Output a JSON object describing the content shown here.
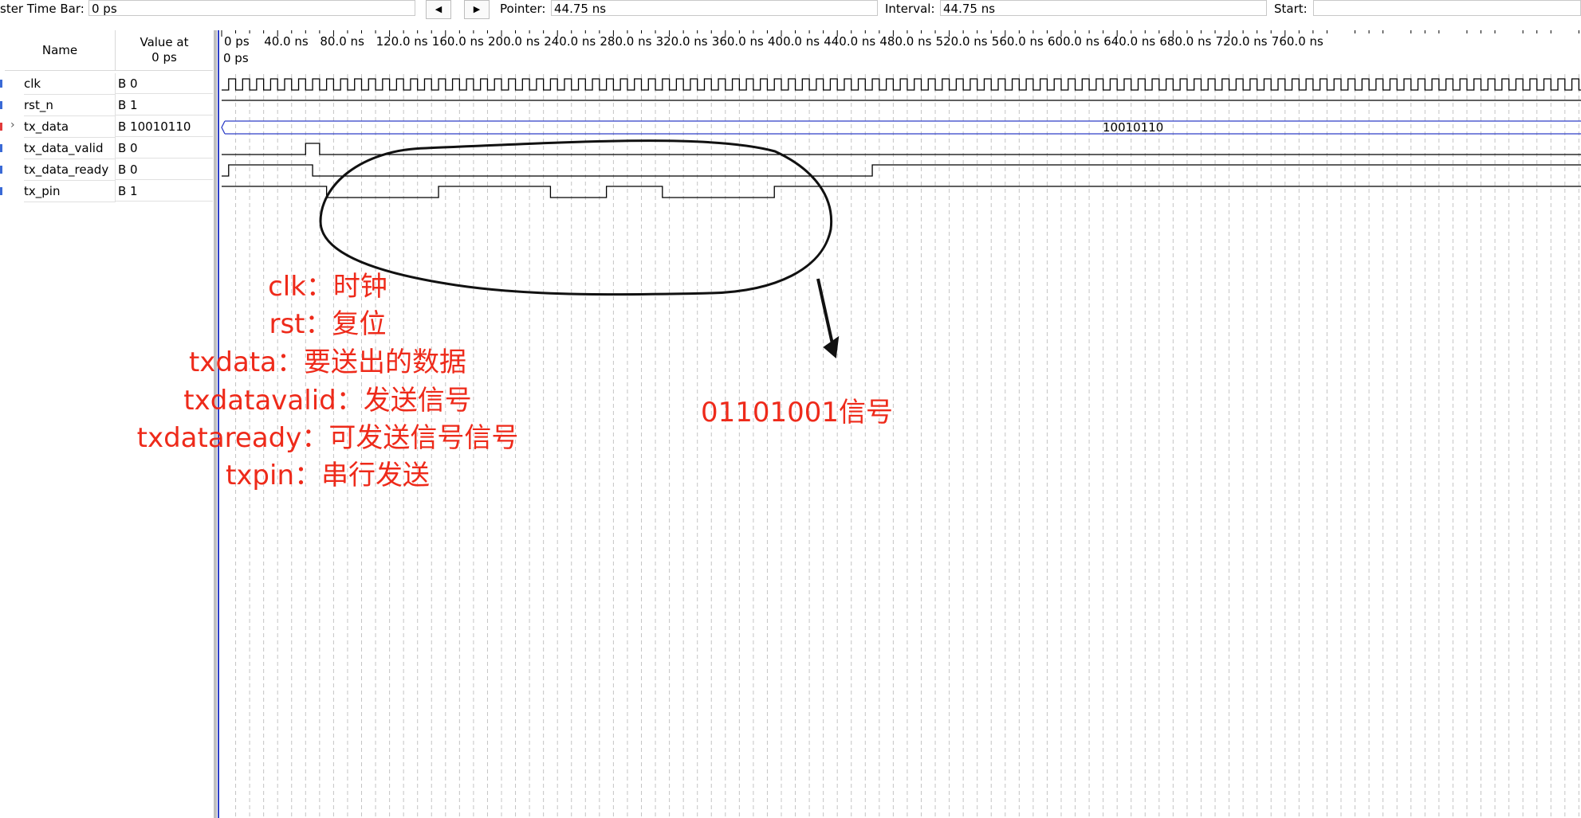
{
  "toolbar": {
    "master_label": "ster Time Bar:",
    "master_value": "0 ps",
    "prev_icon": "triangle-left-icon",
    "next_icon": "triangle-right-icon",
    "pointer_label": "Pointer:",
    "pointer_value": "44.75 ns",
    "interval_label": "Interval:",
    "interval_value": "44.75 ns",
    "start_label": "Start:",
    "start_value": ""
  },
  "columns": {
    "name": "Name",
    "value": "Value at\n0 ps"
  },
  "signals": [
    {
      "name": "clk",
      "value": "B 0",
      "marker_color": "#3a6ad6",
      "expandable": false
    },
    {
      "name": "rst_n",
      "value": "B 1",
      "marker_color": "#3a6ad6",
      "expandable": false
    },
    {
      "name": "tx_data",
      "value": "B 10010110",
      "marker_color": "#e23a3a",
      "expandable": true
    },
    {
      "name": "tx_data_valid",
      "value": "B 0",
      "marker_color": "#3a6ad6",
      "expandable": false
    },
    {
      "name": "tx_data_ready",
      "value": "B 0",
      "marker_color": "#3a6ad6",
      "expandable": false
    },
    {
      "name": "tx_pin",
      "value": "B 1",
      "marker_color": "#3a6ad6",
      "expandable": false
    }
  ],
  "timeline": {
    "ticks": [
      "0 ps",
      "40.0 ns",
      "80.0 ns",
      "120.0 ns",
      "160.0 ns",
      "200.0 ns",
      "240.0 ns",
      "280.0 ns",
      "320.0 ns",
      "360.0 ns",
      "400.0 ns",
      "440.0 ns",
      "480.0 ns",
      "520.0 ns",
      "560.0 ns",
      "600.0 ns",
      "640.0 ns",
      "680.0 ns",
      "720.0 ns",
      "760.0 ns"
    ],
    "cursor_label": "0 ps",
    "clock_period_ns": 10,
    "visible_range_ns": [
      0,
      774
    ]
  },
  "waveforms": {
    "rst_n": [
      [
        0,
        1
      ]
    ],
    "tx_data_bus_value": "10010110",
    "tx_data_valid": [
      [
        0,
        0
      ],
      [
        60,
        1
      ],
      [
        70,
        0
      ]
    ],
    "tx_data_ready": [
      [
        0,
        0
      ],
      [
        5,
        1
      ],
      [
        65,
        0
      ],
      [
        465,
        1
      ]
    ],
    "tx_pin": [
      [
        0,
        1
      ],
      [
        75,
        0
      ],
      [
        155,
        1
      ],
      [
        235,
        0
      ],
      [
        275,
        1
      ],
      [
        315,
        0
      ],
      [
        395,
        1
      ]
    ]
  },
  "annotations": {
    "lines": [
      "clk：时钟",
      "rst：复位",
      "txdata：要送出的数据",
      "txdatavalid：发送信号",
      "txdataready：可发送信号信号",
      "txpin：串行发送"
    ],
    "bits_label": "01101001信号",
    "color": "#ee2a1a",
    "ink_color": "#111111"
  }
}
